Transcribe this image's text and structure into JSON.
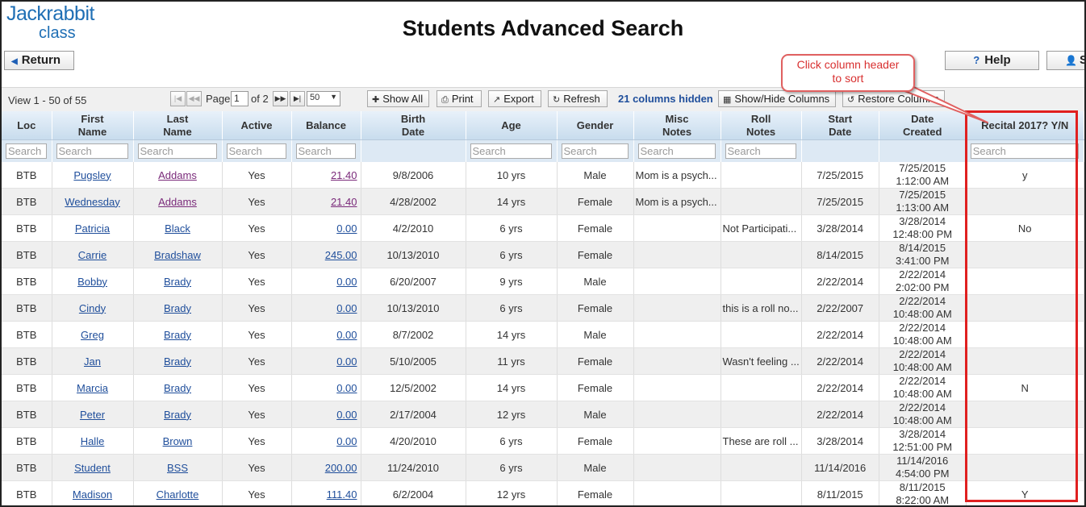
{
  "logo": {
    "line1": "Jackrabbit",
    "line2": "class"
  },
  "page_title": "Students Advanced Search",
  "return_label": "Return",
  "help_label": "Help",
  "partial_button_label": "S",
  "toolbar": {
    "view_label": "View 1 - 50 of 55",
    "page_label": "Page",
    "page_value": "1",
    "of_label": "of 2",
    "per_page": "50",
    "show_all": "Show All",
    "print": "Print",
    "export": "Export",
    "refresh": "Refresh",
    "hidden_columns": "21 columns hidden",
    "show_hide_columns": "Show/Hide Columns",
    "restore_columns": "Restore Columns"
  },
  "columns": [
    {
      "key": "loc",
      "label1": "Loc",
      "label2": "",
      "search": true
    },
    {
      "key": "first",
      "label1": "First",
      "label2": "Name",
      "search": true
    },
    {
      "key": "last",
      "label1": "Last",
      "label2": "Name",
      "search": true
    },
    {
      "key": "active",
      "label1": "Active",
      "label2": "",
      "search": true
    },
    {
      "key": "balance",
      "label1": "Balance",
      "label2": "",
      "search": true
    },
    {
      "key": "birth",
      "label1": "Birth",
      "label2": "Date",
      "search": false
    },
    {
      "key": "age",
      "label1": "Age",
      "label2": "",
      "search": true
    },
    {
      "key": "gender",
      "label1": "Gender",
      "label2": "",
      "search": true
    },
    {
      "key": "misc",
      "label1": "Misc",
      "label2": "Notes",
      "search": true
    },
    {
      "key": "roll",
      "label1": "Roll",
      "label2": "Notes",
      "search": true
    },
    {
      "key": "start",
      "label1": "Start",
      "label2": "Date",
      "search": false
    },
    {
      "key": "created",
      "label1": "Date",
      "label2": "Created",
      "search": false
    },
    {
      "key": "recital",
      "label1": "Recital 2017? Y/N",
      "label2": "",
      "search": true
    }
  ],
  "search_placeholder": "Search",
  "rows": [
    {
      "loc": "BTB",
      "first": "Pugsley",
      "last": "Addams",
      "active": "Yes",
      "balance": "21.40",
      "birth": "9/8/2006",
      "age": "10 yrs",
      "gender": "Male",
      "misc": "Mom is a psych...",
      "roll": "",
      "start": "7/25/2015",
      "created_date": "7/25/2015",
      "created_time": "1:12:00 AM",
      "recital": "y"
    },
    {
      "loc": "BTB",
      "first": "Wednesday",
      "last": "Addams",
      "active": "Yes",
      "balance": "21.40",
      "birth": "4/28/2002",
      "age": "14 yrs",
      "gender": "Female",
      "misc": "Mom is a psych...",
      "roll": "",
      "start": "7/25/2015",
      "created_date": "7/25/2015",
      "created_time": "1:13:00 AM",
      "recital": ""
    },
    {
      "loc": "BTB",
      "first": "Patricia",
      "last": "Black",
      "active": "Yes",
      "balance": "0.00",
      "birth": "4/2/2010",
      "age": "6 yrs",
      "gender": "Female",
      "misc": "",
      "roll": "Not Participati...",
      "start": "3/28/2014",
      "created_date": "3/28/2014",
      "created_time": "12:48:00 PM",
      "recital": "No"
    },
    {
      "loc": "BTB",
      "first": "Carrie",
      "last": "Bradshaw",
      "active": "Yes",
      "balance": "245.00",
      "birth": "10/13/2010",
      "age": "6 yrs",
      "gender": "Female",
      "misc": "",
      "roll": "",
      "start": "8/14/2015",
      "created_date": "8/14/2015",
      "created_time": "3:41:00 PM",
      "recital": ""
    },
    {
      "loc": "BTB",
      "first": "Bobby",
      "last": "Brady",
      "active": "Yes",
      "balance": "0.00",
      "birth": "6/20/2007",
      "age": "9 yrs",
      "gender": "Male",
      "misc": "",
      "roll": "",
      "start": "2/22/2014",
      "created_date": "2/22/2014",
      "created_time": "2:02:00 PM",
      "recital": ""
    },
    {
      "loc": "BTB",
      "first": "Cindy",
      "last": "Brady",
      "active": "Yes",
      "balance": "0.00",
      "birth": "10/13/2010",
      "age": "6 yrs",
      "gender": "Female",
      "misc": "",
      "roll": "this is a roll no...",
      "start": "2/22/2007",
      "created_date": "2/22/2014",
      "created_time": "10:48:00 AM",
      "recital": ""
    },
    {
      "loc": "BTB",
      "first": "Greg",
      "last": "Brady",
      "active": "Yes",
      "balance": "0.00",
      "birth": "8/7/2002",
      "age": "14 yrs",
      "gender": "Male",
      "misc": "",
      "roll": "",
      "start": "2/22/2014",
      "created_date": "2/22/2014",
      "created_time": "10:48:00 AM",
      "recital": ""
    },
    {
      "loc": "BTB",
      "first": "Jan",
      "last": "Brady",
      "active": "Yes",
      "balance": "0.00",
      "birth": "5/10/2005",
      "age": "11 yrs",
      "gender": "Female",
      "misc": "",
      "roll": "Wasn't feeling ...",
      "start": "2/22/2014",
      "created_date": "2/22/2014",
      "created_time": "10:48:00 AM",
      "recital": ""
    },
    {
      "loc": "BTB",
      "first": "Marcia",
      "last": "Brady",
      "active": "Yes",
      "balance": "0.00",
      "birth": "12/5/2002",
      "age": "14 yrs",
      "gender": "Female",
      "misc": "",
      "roll": "",
      "start": "2/22/2014",
      "created_date": "2/22/2014",
      "created_time": "10:48:00 AM",
      "recital": "N"
    },
    {
      "loc": "BTB",
      "first": "Peter",
      "last": "Brady",
      "active": "Yes",
      "balance": "0.00",
      "birth": "2/17/2004",
      "age": "12 yrs",
      "gender": "Male",
      "misc": "",
      "roll": "",
      "start": "2/22/2014",
      "created_date": "2/22/2014",
      "created_time": "10:48:00 AM",
      "recital": ""
    },
    {
      "loc": "BTB",
      "first": "Halle",
      "last": "Brown",
      "active": "Yes",
      "balance": "0.00",
      "birth": "4/20/2010",
      "age": "6 yrs",
      "gender": "Female",
      "misc": "",
      "roll": "These are roll ...",
      "start": "3/28/2014",
      "created_date": "3/28/2014",
      "created_time": "12:51:00 PM",
      "recital": ""
    },
    {
      "loc": "BTB",
      "first": "Student",
      "last": "BSS",
      "active": "Yes",
      "balance": "200.00",
      "birth": "11/24/2010",
      "age": "6 yrs",
      "gender": "Male",
      "misc": "",
      "roll": "",
      "start": "11/14/2016",
      "created_date": "11/14/2016",
      "created_time": "4:54:00 PM",
      "recital": ""
    },
    {
      "loc": "BTB",
      "first": "Madison",
      "last": "Charlotte",
      "active": "Yes",
      "balance": "111.40",
      "birth": "6/2/2004",
      "age": "12 yrs",
      "gender": "Female",
      "misc": "",
      "roll": "",
      "start": "8/11/2015",
      "created_date": "8/11/2015",
      "created_time": "8:22:00 AM",
      "recital": "Y"
    }
  ],
  "annotation": {
    "line1": "Click column header",
    "line2": "to sort",
    "color": "#e02020"
  },
  "colors": {
    "accent": "#1f6fb5",
    "link": "#1f4e9b",
    "visited_link": "#7a2a7a",
    "header_bg": "#d4e4f2"
  }
}
